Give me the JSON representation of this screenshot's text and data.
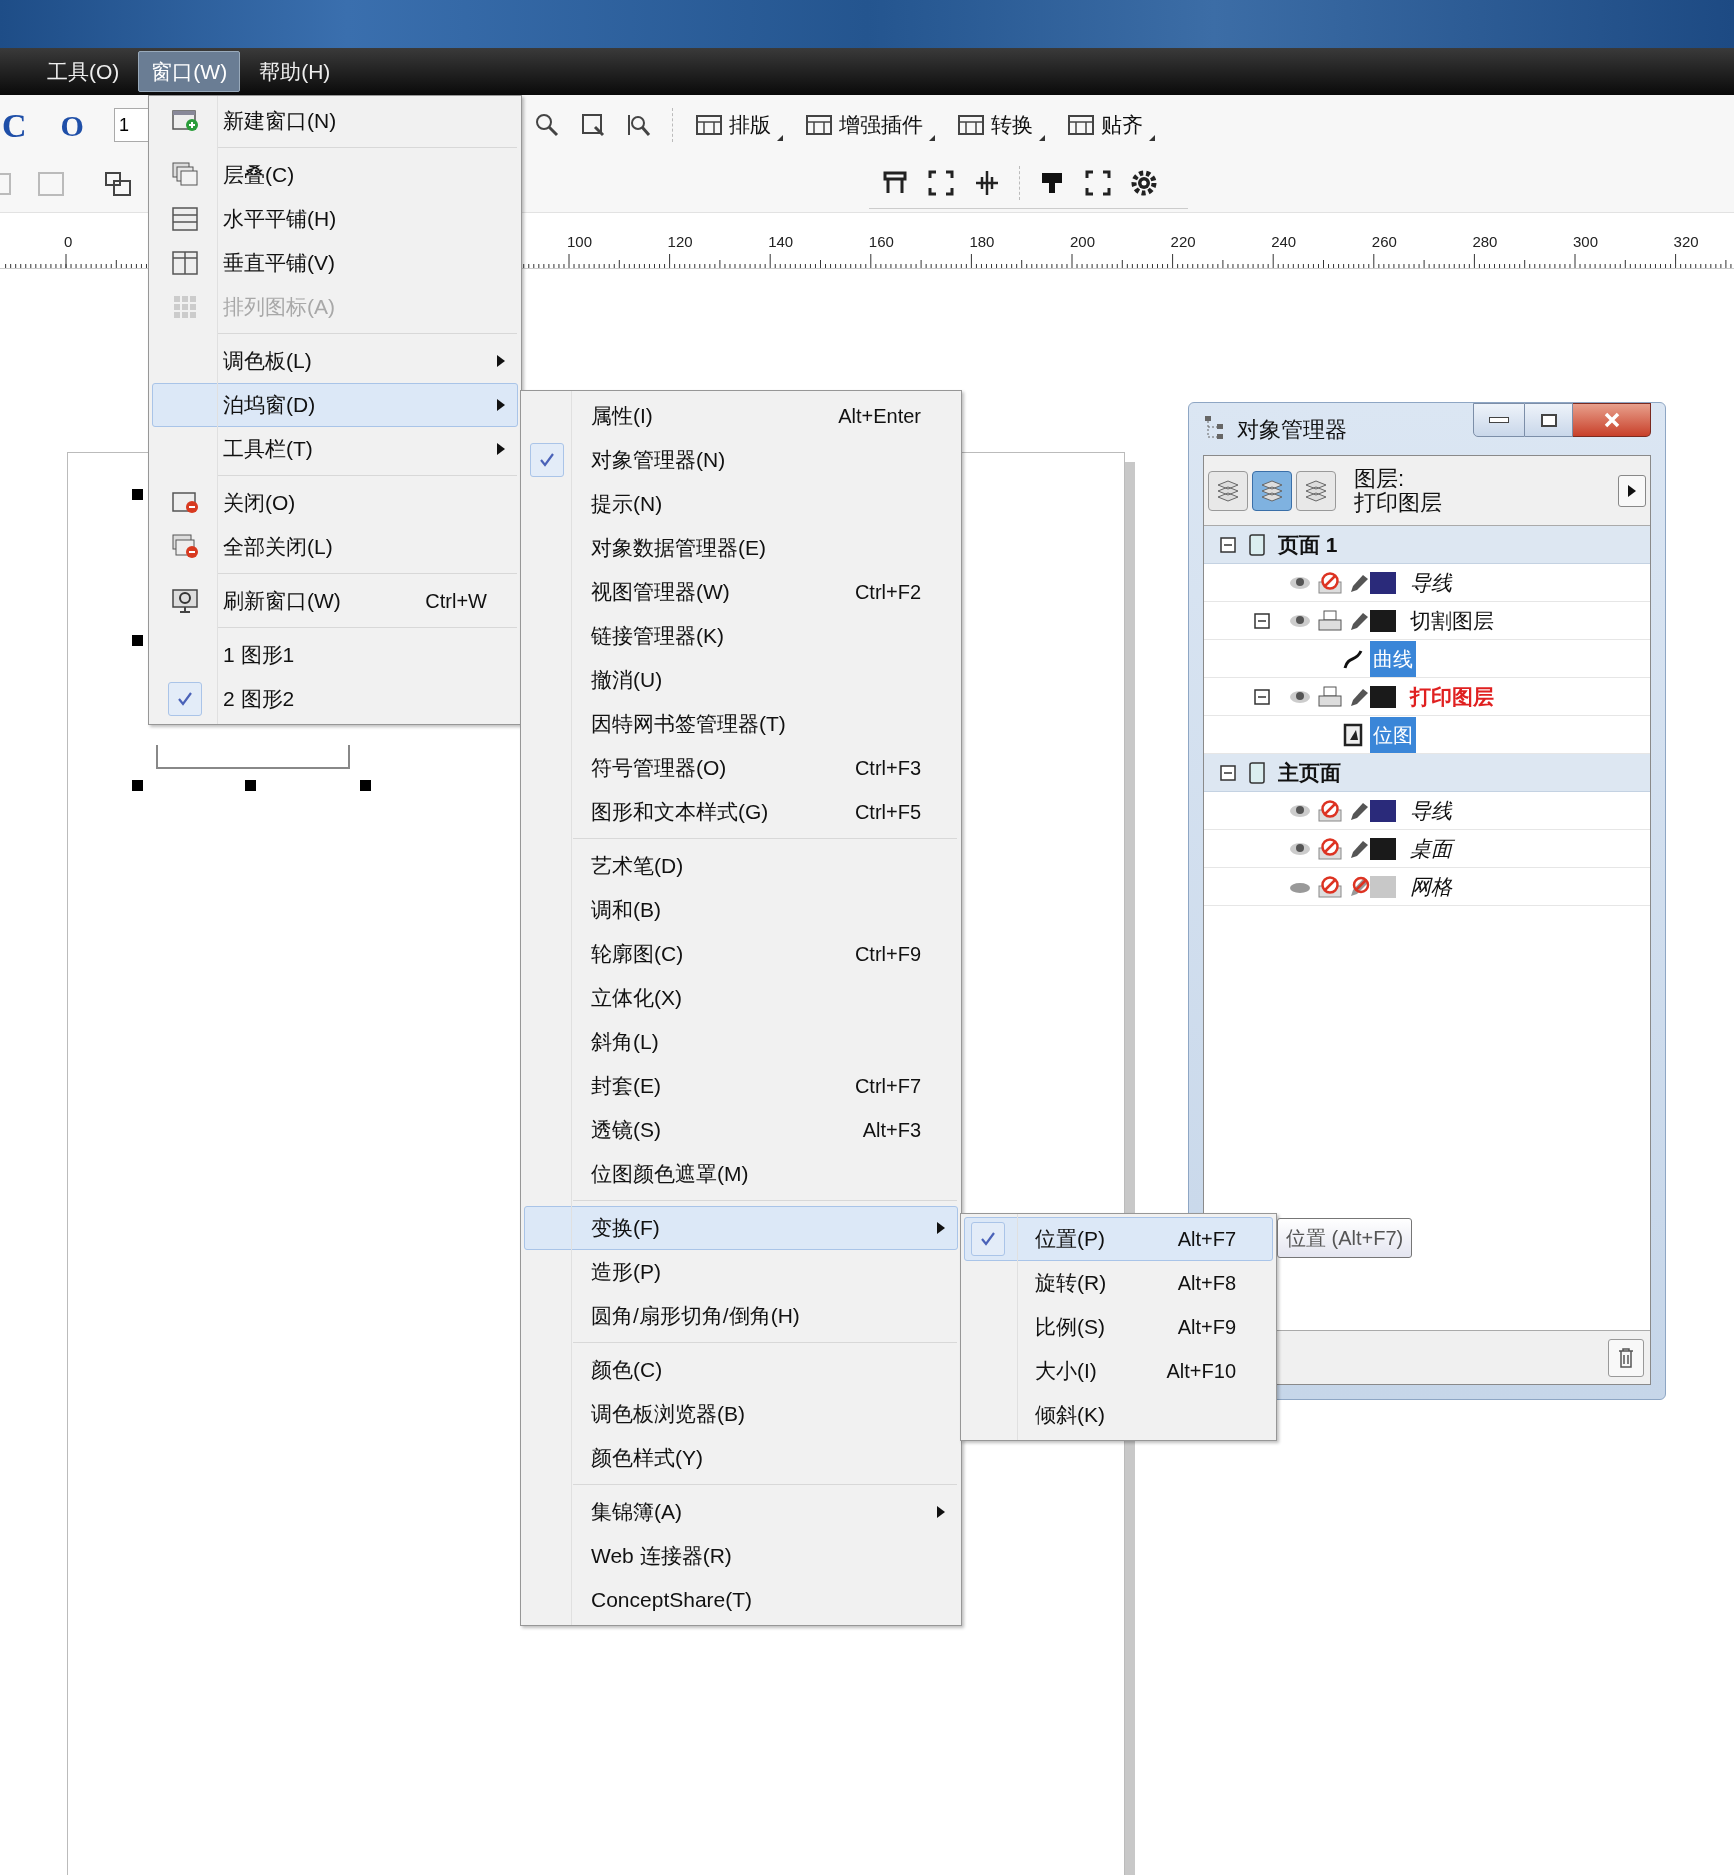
{
  "menu_bar": [
    {
      "label": "工具(O)",
      "selected": false
    },
    {
      "label": "窗口(W)",
      "selected": true
    },
    {
      "label": "帮助(H)",
      "selected": false
    }
  ],
  "toolbar": {
    "glyphs": [
      "C",
      "O"
    ],
    "field_value": "1",
    "buttons": [
      {
        "label": "排版"
      },
      {
        "label": "增强插件"
      },
      {
        "label": "转换"
      },
      {
        "label": "贴齐"
      }
    ]
  },
  "ruler": {
    "labels": [
      "0",
      "100",
      "120",
      "140",
      "160",
      "180",
      "200",
      "220",
      "240",
      "260",
      "280",
      "300",
      "320"
    ]
  },
  "window_menu": [
    [
      {
        "label": "新建窗口(N)",
        "disabled": false,
        "selected": false,
        "checked": false
      }
    ],
    [
      {
        "label": "层叠(C)",
        "disabled": false,
        "selected": false,
        "checked": false
      },
      {
        "label": "水平平铺(H)",
        "disabled": false,
        "selected": false,
        "checked": false
      },
      {
        "label": "垂直平铺(V)",
        "disabled": false,
        "selected": false,
        "checked": false
      },
      {
        "label": "排列图标(A)",
        "disabled": true,
        "selected": false,
        "checked": false
      }
    ],
    [
      {
        "label": "调色板(L)",
        "submenu": true,
        "disabled": false,
        "selected": false,
        "checked": false
      },
      {
        "label": "泊坞窗(D)",
        "submenu": true,
        "disabled": false,
        "selected": true,
        "checked": false
      },
      {
        "label": "工具栏(T)",
        "submenu": true,
        "disabled": false,
        "selected": false,
        "checked": false
      }
    ],
    [
      {
        "label": "关闭(O)",
        "disabled": false,
        "selected": false,
        "checked": false
      },
      {
        "label": "全部关闭(L)",
        "disabled": false,
        "selected": false,
        "checked": false
      }
    ],
    [
      {
        "label": "刷新窗口(W)",
        "shortcut": "Ctrl+W",
        "disabled": false,
        "selected": false,
        "checked": false
      }
    ],
    [
      {
        "label": "1 图形1",
        "disabled": false,
        "selected": false,
        "checked": false
      },
      {
        "label": "2 图形2",
        "disabled": false,
        "selected": false,
        "checked": true
      }
    ]
  ],
  "docker_menu": [
    [
      {
        "label": "属性(I)",
        "shortcut": "Alt+Enter",
        "checked": false,
        "selected": false
      },
      {
        "label": "对象管理器(N)",
        "checked": true,
        "selected": false
      },
      {
        "label": "提示(N)",
        "checked": false,
        "selected": false
      },
      {
        "label": "对象数据管理器(E)",
        "checked": false,
        "selected": false
      },
      {
        "label": "视图管理器(W)",
        "shortcut": "Ctrl+F2",
        "checked": false,
        "selected": false
      },
      {
        "label": "链接管理器(K)",
        "checked": false,
        "selected": false
      },
      {
        "label": "撤消(U)",
        "checked": false,
        "selected": false
      },
      {
        "label": "因特网书签管理器(T)",
        "checked": false,
        "selected": false
      },
      {
        "label": "符号管理器(O)",
        "shortcut": "Ctrl+F3",
        "checked": false,
        "selected": false
      },
      {
        "label": "图形和文本样式(G)",
        "shortcut": "Ctrl+F5",
        "checked": false,
        "selected": false
      }
    ],
    [
      {
        "label": "艺术笔(D)",
        "checked": false,
        "selected": false
      },
      {
        "label": "调和(B)",
        "checked": false,
        "selected": false
      },
      {
        "label": "轮廓图(C)",
        "shortcut": "Ctrl+F9",
        "checked": false,
        "selected": false
      },
      {
        "label": "立体化(X)",
        "checked": false,
        "selected": false
      },
      {
        "label": "斜角(L)",
        "checked": false,
        "selected": false
      },
      {
        "label": "封套(E)",
        "shortcut": "Ctrl+F7",
        "checked": false,
        "selected": false
      },
      {
        "label": "透镜(S)",
        "shortcut": "Alt+F3",
        "checked": false,
        "selected": false
      },
      {
        "label": "位图颜色遮罩(M)",
        "checked": false,
        "selected": false
      }
    ],
    [
      {
        "label": "变换(F)",
        "submenu": true,
        "checked": false,
        "selected": true
      },
      {
        "label": "造形(P)",
        "checked": false,
        "selected": false
      },
      {
        "label": "圆角/扇形切角/倒角(H)",
        "checked": false,
        "selected": false
      }
    ],
    [
      {
        "label": "颜色(C)",
        "checked": false,
        "selected": false
      },
      {
        "label": "调色板浏览器(B)",
        "checked": false,
        "selected": false
      },
      {
        "label": "颜色样式(Y)",
        "checked": false,
        "selected": false
      }
    ],
    [
      {
        "label": "集锦簿(A)",
        "submenu": true,
        "checked": false,
        "selected": false
      },
      {
        "label": "Web 连接器(R)",
        "checked": false,
        "selected": false
      },
      {
        "label": "ConceptShare(T)",
        "checked": false,
        "selected": false
      }
    ]
  ],
  "transform_menu": [
    {
      "label": "位置(P)",
      "shortcut": "Alt+F7",
      "checked": true,
      "selected": true
    },
    {
      "label": "旋转(R)",
      "shortcut": "Alt+F8",
      "checked": false,
      "selected": false
    },
    {
      "label": "比例(S)",
      "shortcut": "Alt+F9",
      "checked": false,
      "selected": false
    },
    {
      "label": "大小(I)",
      "shortcut": "Alt+F10",
      "checked": false,
      "selected": false
    },
    {
      "label": "倾斜(K)",
      "checked": false,
      "selected": false
    }
  ],
  "tooltip": "位置 (Alt+F7)",
  "object_manager": {
    "title": "对象管理器",
    "view_buttons": [
      {
        "selected": false
      },
      {
        "selected": true
      },
      {
        "selected": false
      }
    ],
    "layer_label": "图层:",
    "current_layer": "打印图层",
    "tree": [
      {
        "kind": "page",
        "name": "页面 1",
        "expanded": true,
        "children": [
          {
            "kind": "layer",
            "name": "导线",
            "visible": true,
            "printable": false,
            "editable": true,
            "color": "#2a2a7a",
            "italic": true,
            "active": false,
            "expanded": false
          },
          {
            "kind": "layer",
            "name": "切割图层",
            "visible": true,
            "printable": true,
            "editable": true,
            "color": "#1a1a1a",
            "italic": false,
            "active": false,
            "expanded": true,
            "children": [
              {
                "kind": "curve",
                "name": "曲线",
                "selected": true
              }
            ]
          },
          {
            "kind": "layer",
            "name": "打印图层",
            "visible": true,
            "printable": true,
            "editable": true,
            "color": "#1a1a1a",
            "italic": false,
            "active": true,
            "expanded": true,
            "children": [
              {
                "kind": "bitmap",
                "name": "位图",
                "selected": true
              }
            ]
          }
        ]
      },
      {
        "kind": "page",
        "name": "主页面",
        "expanded": true,
        "children": [
          {
            "kind": "layer",
            "name": "导线",
            "visible": true,
            "printable": false,
            "editable": true,
            "color": "#2a2a7a",
            "italic": true,
            "active": false,
            "expanded": false
          },
          {
            "kind": "layer",
            "name": "桌面",
            "visible": true,
            "printable": false,
            "editable": true,
            "color": "#1a1a1a",
            "italic": true,
            "active": false,
            "expanded": false
          },
          {
            "kind": "layer",
            "name": "网格",
            "visible": false,
            "printable": false,
            "editable": false,
            "color": "#c8c8c8",
            "italic": true,
            "active": false,
            "expanded": false
          }
        ]
      }
    ]
  }
}
